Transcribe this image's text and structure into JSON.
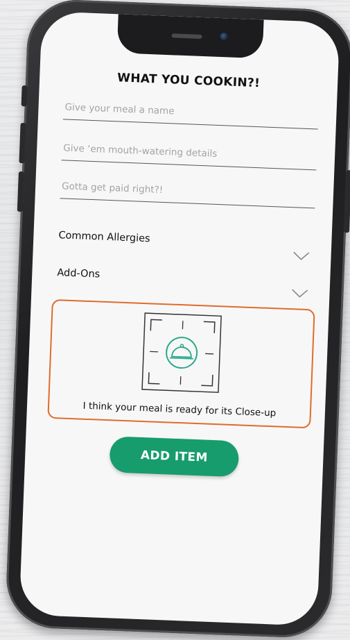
{
  "form": {
    "title": "WHAT YOU COOKIN?!",
    "meal_name_placeholder": "Give your meal a name",
    "details_placeholder": "Give ‘em mouth-watering details",
    "price_placeholder": "Gotta get paid right?!"
  },
  "sections": {
    "allergies_label": "Common Allergies",
    "addons_label": "Add-Ons"
  },
  "upload": {
    "caption": "I think your meal is ready for its Close-up",
    "icon": "cloche-camera-icon"
  },
  "actions": {
    "add_item_label": "ADD ITEM"
  },
  "colors": {
    "accent_green": "#179c6e",
    "highlight_orange": "#e06b2b",
    "icon_teal": "#2aa98a"
  }
}
